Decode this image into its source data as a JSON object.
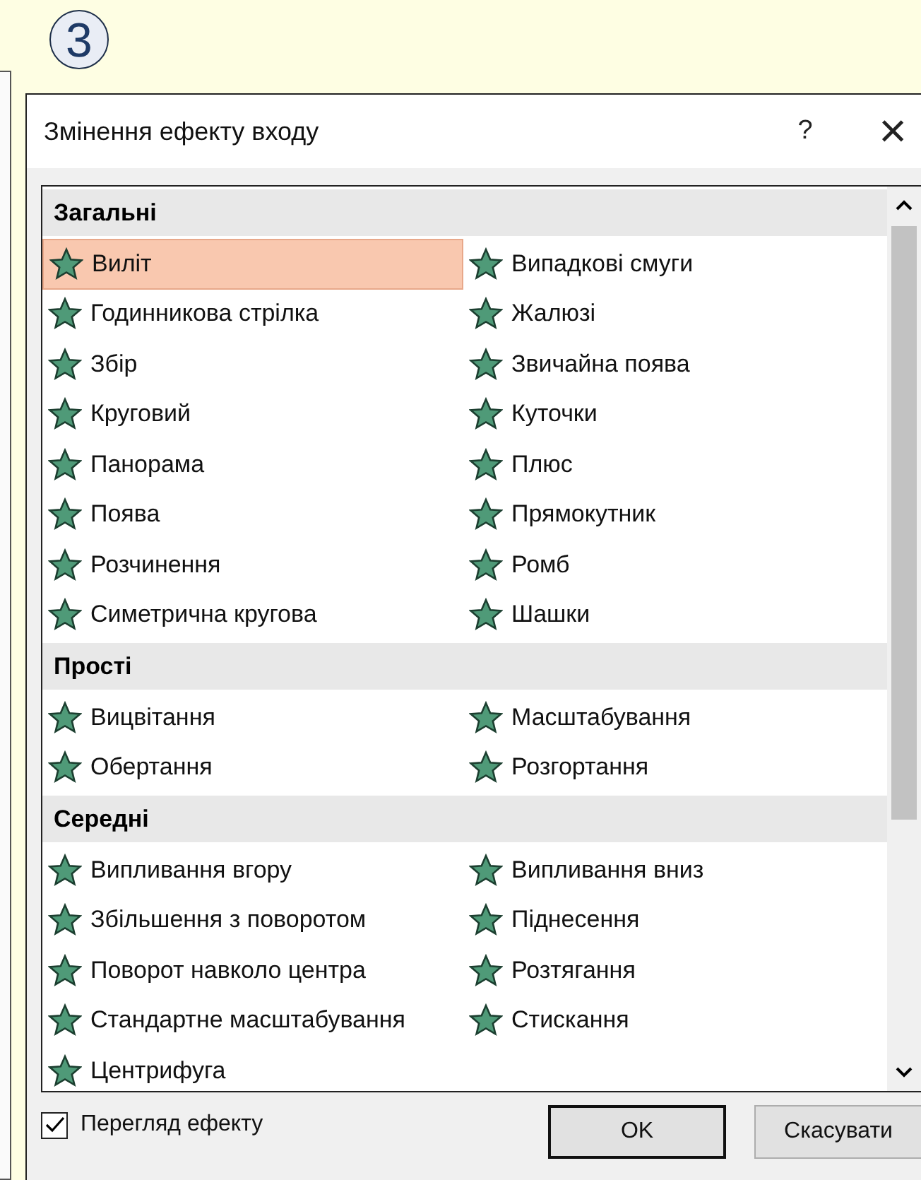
{
  "step_badge": "3",
  "dialog": {
    "title": "Змінення ефекту входу",
    "help": "?",
    "close": "×"
  },
  "sections": [
    {
      "title": "Загальні",
      "items": [
        {
          "label": "Виліт",
          "selected": true
        },
        {
          "label": "Випадкові смуги",
          "selected": false
        },
        {
          "label": "Годинникова стрілка",
          "selected": false
        },
        {
          "label": "Жалюзі",
          "selected": false
        },
        {
          "label": "Збір",
          "selected": false
        },
        {
          "label": "Звичайна поява",
          "selected": false
        },
        {
          "label": "Круговий",
          "selected": false
        },
        {
          "label": "Куточки",
          "selected": false
        },
        {
          "label": "Панорама",
          "selected": false
        },
        {
          "label": "Плюс",
          "selected": false
        },
        {
          "label": "Поява",
          "selected": false
        },
        {
          "label": "Прямокутник",
          "selected": false
        },
        {
          "label": "Розчинення",
          "selected": false
        },
        {
          "label": "Ромб",
          "selected": false
        },
        {
          "label": "Симетрична кругова",
          "selected": false
        },
        {
          "label": "Шашки",
          "selected": false
        }
      ]
    },
    {
      "title": "Прості",
      "items": [
        {
          "label": "Вицвітання",
          "selected": false
        },
        {
          "label": "Масштабування",
          "selected": false
        },
        {
          "label": "Обертання",
          "selected": false
        },
        {
          "label": "Розгортання",
          "selected": false
        }
      ]
    },
    {
      "title": "Середні",
      "items": [
        {
          "label": "Випливання вгору",
          "selected": false
        },
        {
          "label": "Випливання вниз",
          "selected": false
        },
        {
          "label": "Збільшення з поворотом",
          "selected": false
        },
        {
          "label": "Піднесення",
          "selected": false
        },
        {
          "label": "Поворот навколо центра",
          "selected": false
        },
        {
          "label": "Розтягання",
          "selected": false
        },
        {
          "label": "Стандартне масштабування",
          "selected": false
        },
        {
          "label": "Стискання",
          "selected": false
        },
        {
          "label": "Центрифуга",
          "selected": false
        }
      ]
    }
  ],
  "preview": {
    "label": "Перегляд ефекту",
    "checked": true
  },
  "buttons": [
    "OK",
    "Скасувати"
  ]
}
